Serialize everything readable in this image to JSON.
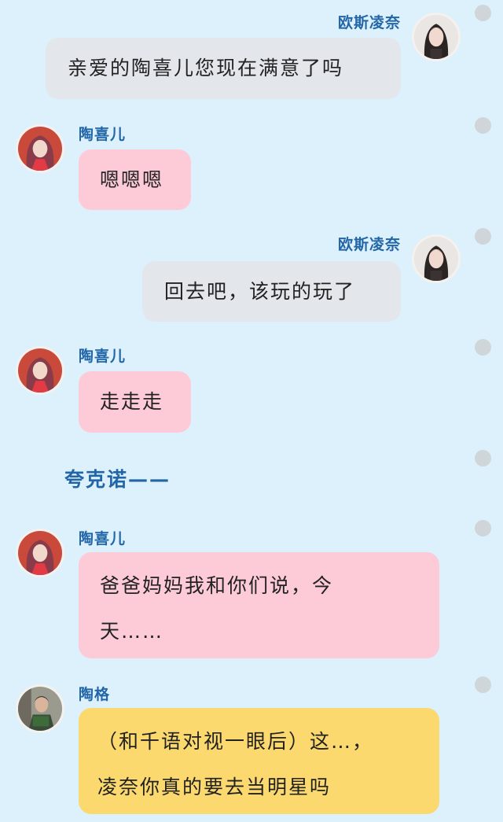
{
  "messages": [
    {
      "speaker": "欧斯凌奈",
      "side": "right",
      "text": "亲爱的陶喜儿您现在满意了吗",
      "avatar": "woman-dark-hair-avatar"
    },
    {
      "speaker": "陶喜儿",
      "side": "left",
      "text": "嗯嗯嗯",
      "avatar": "woman-pink-hair-avatar"
    },
    {
      "speaker": "欧斯凌奈",
      "side": "right",
      "text": "回去吧，该玩的玩了",
      "avatar": "woman-dark-hair-avatar"
    },
    {
      "speaker": "陶喜儿",
      "side": "left",
      "text": "走走走",
      "avatar": "woman-pink-hair-avatar"
    },
    {
      "speaker": "陶喜儿",
      "side": "left",
      "text": "爸爸妈妈我和你们说，今天……",
      "line1": "爸爸妈妈我和你们说，今",
      "line2": "天……",
      "avatar": "woman-pink-hair-avatar"
    },
    {
      "speaker": "陶格",
      "side": "left",
      "text": "（和千语对视一眼后）这…，凌奈你真的要去当明星吗",
      "line1": "（和千语对视一眼后）这…，",
      "line2": "凌奈你真的要去当明星吗",
      "avatar": "man-reading-avatar"
    }
  ],
  "narration": "夸克诺——",
  "colors": {
    "background": "#dcf1fb",
    "name": "#2366a8",
    "bubble_gray": "#e3e7ec",
    "bubble_pink": "#fdcbd8",
    "bubble_yellow": "#fbd96e"
  }
}
